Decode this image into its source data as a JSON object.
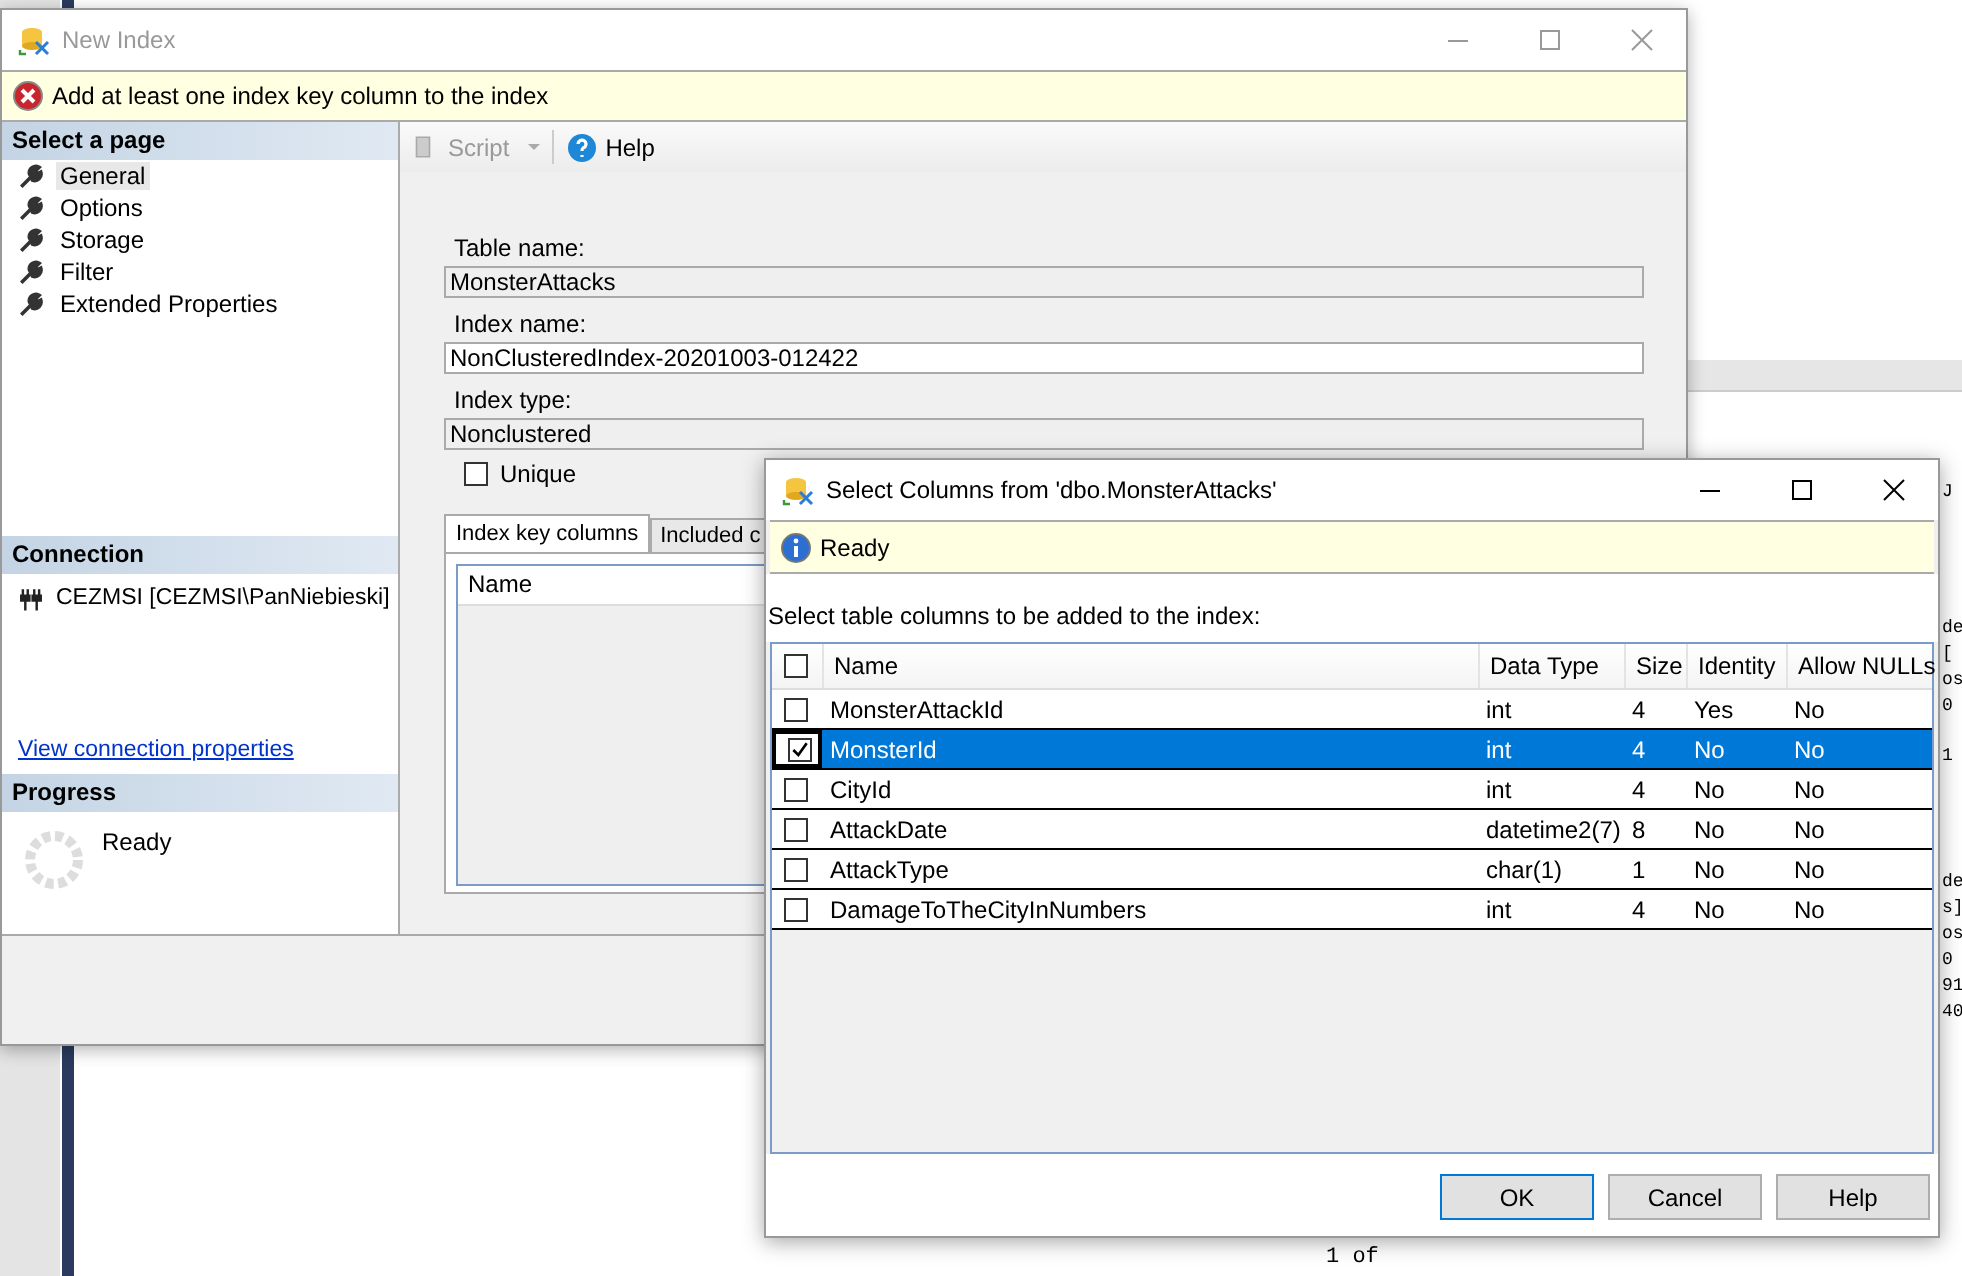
{
  "background_editor": {
    "right_edge_fragments": [
      [
        "J"
      ],
      [
        "de",
        "[",
        "os",
        "0"
      ],
      [
        "1"
      ],
      [
        "de",
        "s]",
        "os",
        "0",
        "91",
        "40"
      ]
    ],
    "footer": "1 of"
  },
  "main_window": {
    "title": "New Index",
    "error": "Add at least one index key column to the index",
    "select_page": {
      "heading": "Select a page",
      "items": [
        {
          "label": "General",
          "selected": true
        },
        {
          "label": "Options",
          "selected": false
        },
        {
          "label": "Storage",
          "selected": false
        },
        {
          "label": "Filter",
          "selected": false
        },
        {
          "label": "Extended Properties",
          "selected": false
        }
      ]
    },
    "connection": {
      "heading": "Connection",
      "server": "CEZMSI [CEZMSI\\PanNiebieski]",
      "link": "View connection properties"
    },
    "progress": {
      "heading": "Progress",
      "status": "Ready"
    },
    "toolbar": {
      "script": "Script",
      "help": "Help"
    },
    "fields": [
      {
        "label": "Table name:",
        "value": "MonsterAttacks",
        "disabled": true
      },
      {
        "label": "Index name:",
        "value": "NonClusteredIndex-20201003-012422",
        "disabled": false
      },
      {
        "label": "Index type:",
        "value": "Nonclustered",
        "disabled": true
      }
    ],
    "unique": {
      "label": "Unique",
      "checked": false
    },
    "tabs": [
      {
        "label": "Index key columns",
        "selected": true
      },
      {
        "label": "Included c",
        "selected": false
      }
    ],
    "grid_columns": [
      "Name"
    ]
  },
  "dialog": {
    "title": "Select Columns from 'dbo.MonsterAttacks'",
    "status": "Ready",
    "instruction": "Select table columns to be added to the index:",
    "all_checked": false,
    "columns": [
      "Name",
      "Data Type",
      "Size",
      "Identity",
      "Allow NULLs"
    ],
    "rows": [
      {
        "checked": false,
        "selected": false,
        "cells": [
          "MonsterAttackId",
          "int",
          "4",
          "Yes",
          "No"
        ]
      },
      {
        "checked": true,
        "selected": true,
        "cells": [
          "MonsterId",
          "int",
          "4",
          "No",
          "No"
        ]
      },
      {
        "checked": false,
        "selected": false,
        "cells": [
          "CityId",
          "int",
          "4",
          "No",
          "No"
        ]
      },
      {
        "checked": false,
        "selected": false,
        "cells": [
          "AttackDate",
          "datetime2(7)",
          "8",
          "No",
          "No"
        ]
      },
      {
        "checked": false,
        "selected": false,
        "cells": [
          "AttackType",
          "char(1)",
          "1",
          "No",
          "No"
        ]
      },
      {
        "checked": false,
        "selected": false,
        "cells": [
          "DamageToTheCityInNumbers",
          "int",
          "4",
          "No",
          "No"
        ]
      }
    ],
    "buttons": [
      {
        "label": "OK",
        "default": true
      },
      {
        "label": "Cancel",
        "default": false
      },
      {
        "label": "Help",
        "default": false
      }
    ]
  }
}
